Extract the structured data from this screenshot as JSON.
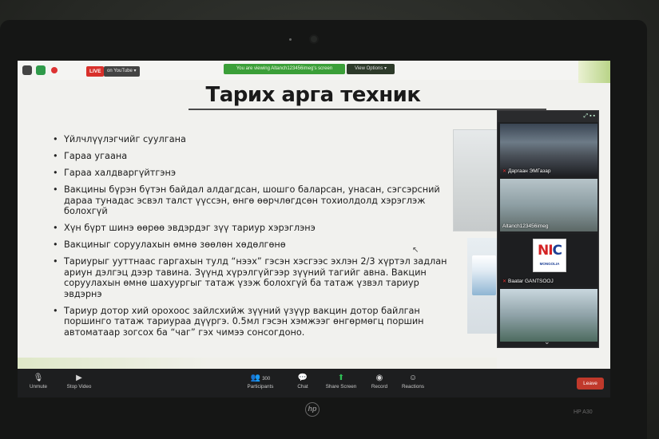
{
  "topbar": {
    "live_label": "LIVE",
    "stream_label": "on YouTube ▾",
    "viewing_banner": "You are viewing Altanch123456imeg's screen",
    "view_options_label": "View Options ▾"
  },
  "slide": {
    "title": "Тарих арга техник",
    "bullets": [
      "Үйлчлүүлэгчийг суулгана",
      "Гараа угаана",
      "Гараа халдваргүйтгэнэ",
      "Вакцины бүрэн бүтэн байдал алдагдсан, шошго баларсан, унасан, сэгсэрсний дараа тунадас  эсвэл талст үүссэн, өнгө өөрчлөгдсөн тохиолдолд хэрэглэж болохгүй",
      "Хүн бүрт шинэ өөрөө эвдэрдэг зүү тариур хэрэглэнэ",
      "Вакциныг соруулахын өмнө зөөлөн хөдөлгөнө",
      "Тариурыг ууттнаас гаргахын тулд “нээх” гэсэн хэсгээс эхлэн 2/3 хүртэл задлан ариун дэлгэц дээр тавина. Зүүнд хүрэлгүйгээр зүүний тагийг авна. Вакцин соруулахын өмнө шахуургыг татаж үзэж болохгүй ба татаж үзвэл тариур эвдэрнэ",
      "Тариур дотор хий орохоос зайлсхийж зүүний үзүүр вакцин дотор байлган поршинго татаж тариураа дүүргэ. 0.5мл гэсэн хэмжээг өнгөрмөгц поршин автоматаар зогсох ба “чаг” гэх чимээ сонсогдоно."
    ]
  },
  "video_panel": {
    "header_icons": "⤢ ▪ ▪",
    "tiles": [
      {
        "name": "Даргаан ЭМГазар"
      },
      {
        "name": "Altanch123456imeg"
      },
      {
        "name": "Baatar GANTSOOJ",
        "logo_main_red": "NI",
        "logo_main_blue": "C",
        "logo_sub": "MONGOLIA"
      },
      {
        "name": ""
      }
    ]
  },
  "toolbar": {
    "unmute": "Unmute",
    "stop_video": "Stop Video",
    "participants": "Participants",
    "participants_count": "300",
    "chat": "Chat",
    "share_screen": "Share Screen",
    "record": "Record",
    "reactions": "Reactions",
    "leave": "Leave"
  },
  "device": {
    "brand": "hp",
    "model": "HP A30"
  },
  "colors": {
    "live_red": "#d8302b",
    "banner_green": "#3b9f39",
    "share_green": "#2fbf55",
    "leave_red": "#c0392b",
    "nic_red": "#d42224",
    "nic_blue": "#1c3f94"
  }
}
